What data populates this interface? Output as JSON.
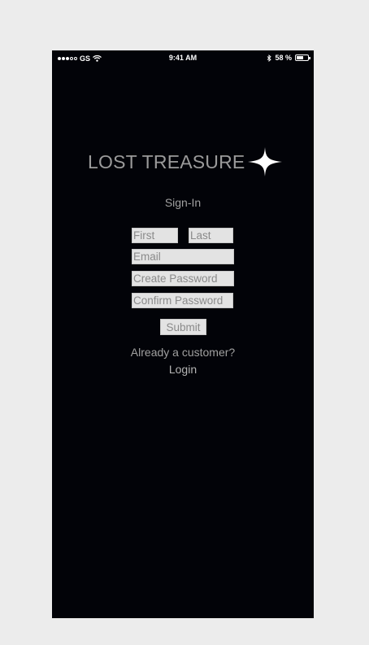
{
  "status_bar": {
    "carrier": "GS",
    "time": "9:41 AM",
    "battery_percent": "58 %",
    "battery_level": 0.58,
    "signal_bars_filled": 3,
    "signal_bars_total": 5
  },
  "brand": {
    "title": "LOST TREASURE",
    "logo_icon": "four-point-star-icon"
  },
  "form": {
    "heading": "Sign-In",
    "first_placeholder": "First",
    "last_placeholder": "Last",
    "email_placeholder": "Email",
    "create_password_placeholder": "Create Password",
    "confirm_password_placeholder": "Confirm Password",
    "submit_label": "Submit"
  },
  "footer": {
    "prompt": "Already a customer?",
    "login_label": "Login"
  },
  "colors": {
    "screen_background": "#020308",
    "page_background": "#ececec",
    "field_background": "#e3e3e3",
    "text_muted": "#a0a0a0"
  }
}
